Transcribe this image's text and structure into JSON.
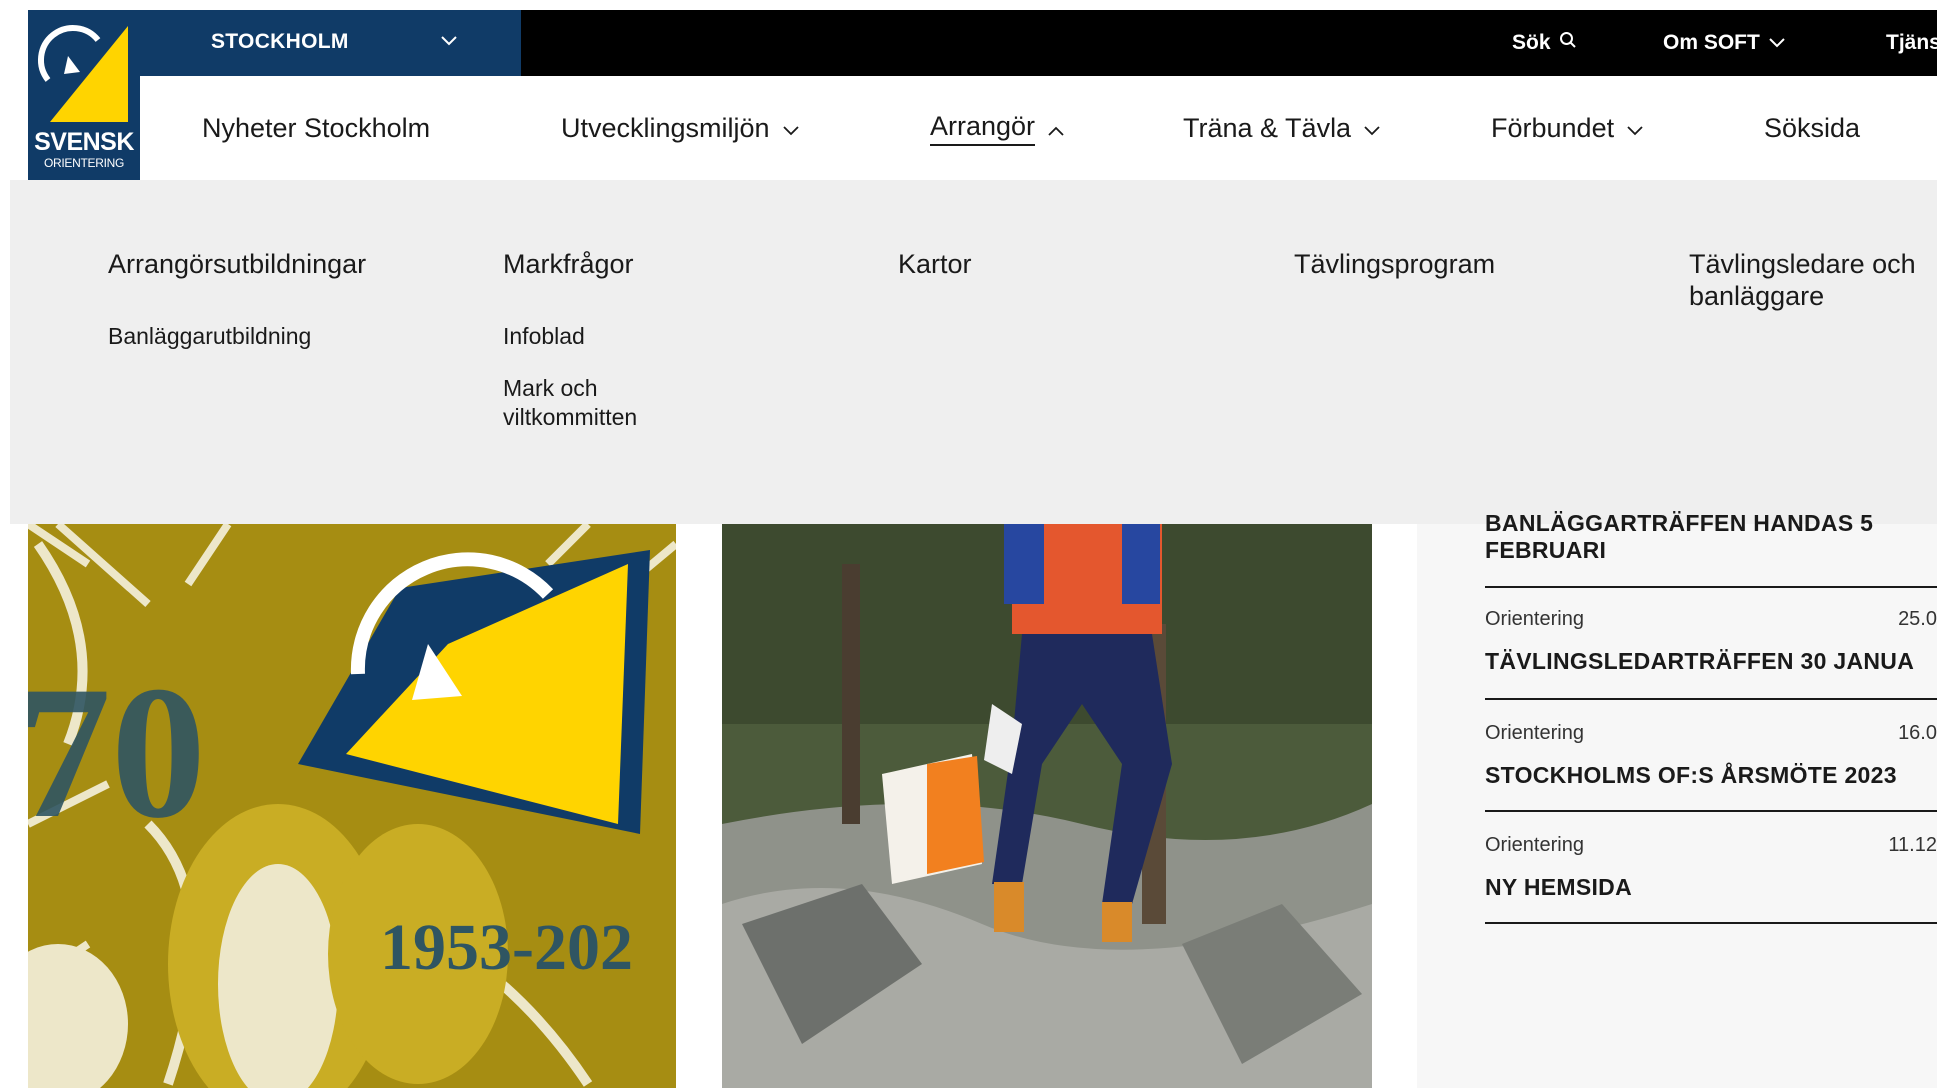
{
  "topbar": {
    "region_label": "STOCKHOLM",
    "search_label": "Sök",
    "om_label": "Om SOFT",
    "tjanster_label": "Tjäns"
  },
  "logo": {
    "line1": "SVENSK",
    "line2": "ORIENTERING"
  },
  "nav": {
    "items": [
      {
        "label": "Nyheter Stockholm"
      },
      {
        "label": "Utvecklingsmiljön"
      },
      {
        "label": "Arrangör"
      },
      {
        "label": "Träna & Tävla"
      },
      {
        "label": "Förbundet"
      },
      {
        "label": "Söksida"
      }
    ]
  },
  "dropdown": {
    "col1": {
      "heading": "Arrangörsutbildningar",
      "links": [
        "Banläggarutbildning"
      ]
    },
    "col2": {
      "heading": "Markfrågor",
      "links": [
        "Infoblad",
        "Mark och",
        "viltkommitten"
      ]
    },
    "col3": {
      "heading": "Kartor"
    },
    "col4": {
      "heading": "Tävlingsprogram"
    },
    "col5": {
      "heading_line1": "Tävlingsledare och",
      "heading_line2": "banläggare"
    }
  },
  "images": {
    "badge_year": "70",
    "badge_range": "1953-202"
  },
  "news": {
    "partial_title": "BANLÄGGARTRÄFFEN HANDAS 5",
    "first_title": "FEBRUARI",
    "items": [
      {
        "category": "Orientering",
        "date": "25.0",
        "title": "TÄVLINGSLEDARTRÄFFEN 30 JANUA"
      },
      {
        "category": "Orientering",
        "date": "16.0",
        "title": "STOCKHOLMS OF:S ÅRSMÖTE 2023"
      },
      {
        "category": "Orientering",
        "date": "11.12",
        "title": "NY HEMSIDA"
      }
    ]
  },
  "colors": {
    "brand_navy": "#103b67",
    "brand_yellow": "#ffd400",
    "dropdown_bg": "#efefef",
    "topbar_bg": "#000000"
  },
  "icons": [
    "chevron-down-icon",
    "chevron-up-icon",
    "search-icon",
    "compass-icon"
  ]
}
